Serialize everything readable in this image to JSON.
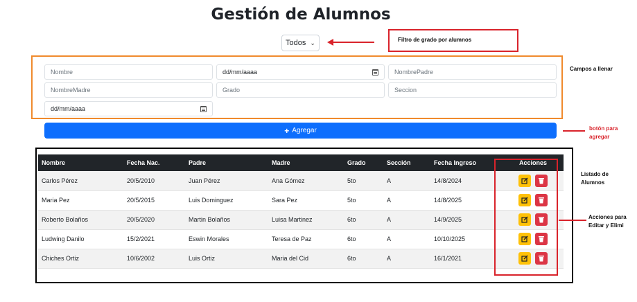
{
  "page": {
    "title": "Gestión de Alumnos"
  },
  "filter": {
    "selected": "Todos"
  },
  "annotations": {
    "filter_note": "Filtro de grado  por alumnos",
    "fields_note": "Campos a llenar",
    "add_note": "botón para agregar",
    "list_note": "Listado de Alumnos",
    "actions_note": "Acciones para Editar y Elimi"
  },
  "form": {
    "nombre_placeholder": "Nombre",
    "fecha_nac_value": "dd/mm/aaaa",
    "nombre_padre_placeholder": "NombrePadre",
    "nombre_madre_placeholder": "NombreMadre",
    "grado_placeholder": "Grado",
    "seccion_placeholder": "Seccion",
    "fecha_ingreso_value": "dd/mm/aaaa",
    "add_label": "Agregar"
  },
  "table": {
    "headers": [
      "Nombre",
      "Fecha Nac.",
      "Padre",
      "Madre",
      "Grado",
      "Sección",
      "Fecha Ingreso",
      "Acciones"
    ],
    "rows": [
      [
        "Carlos Pérez",
        "20/5/2010",
        "Juan Pérez",
        "Ana Gómez",
        "5to",
        "A",
        "14/8/2024"
      ],
      [
        "Maria Pez",
        "20/5/2015",
        "Luis Dominguez",
        "Sara Pez",
        "5to",
        "A",
        "14/8/2025"
      ],
      [
        "Roberto Bolaños",
        "20/5/2020",
        "Martin Bolaños",
        "Luisa Martinez",
        "6to",
        "A",
        "14/9/2025"
      ],
      [
        "Ludwing Danilo",
        "15/2/2021",
        "Eswin Morales",
        "Teresa de Paz",
        "6to",
        "A",
        "10/10/2025"
      ],
      [
        "Chiches Ortiz",
        "10/6/2002",
        "Luis Ortiz",
        "Maria del Cid",
        "6to",
        "A",
        "16/1/2021"
      ]
    ]
  },
  "colors": {
    "primary": "#0d6efd",
    "warning": "#ffc107",
    "danger": "#dc3545",
    "table_header": "#212529",
    "annotation_red": "#d9232b",
    "annotation_orange": "#f08a2c"
  }
}
